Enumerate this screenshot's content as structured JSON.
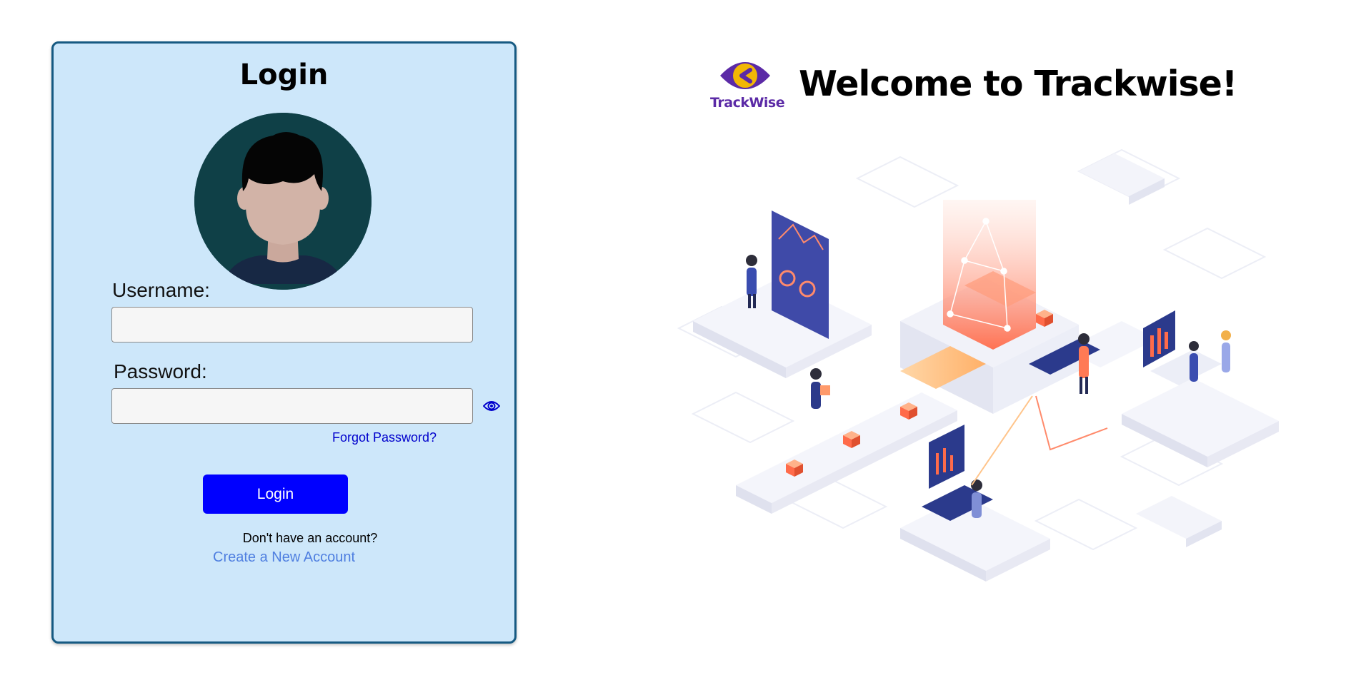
{
  "login": {
    "title": "Login",
    "username_label": "Username:",
    "username_value": "",
    "password_label": "Password:",
    "password_value": "",
    "forgot_password": "Forgot Password?",
    "login_button": "Login",
    "no_account_text": "Don't have an account?",
    "create_account_link": "Create a New Account"
  },
  "brand": {
    "logo_text": "TrackWise",
    "welcome": "Welcome to Trackwise!"
  },
  "icons": {
    "avatar": "user-avatar",
    "show_password": "eye-icon",
    "logo": "eye-logo-icon",
    "illustration": "isometric-tracking-illustration"
  },
  "colors": {
    "card_background": "#cde7fa",
    "card_border": "#165a82",
    "primary_button": "#0000ff",
    "link": "#0000cc",
    "create_link": "#4f7fe0",
    "brand_purple": "#5b2aa6",
    "brand_yellow": "#f2b705"
  }
}
